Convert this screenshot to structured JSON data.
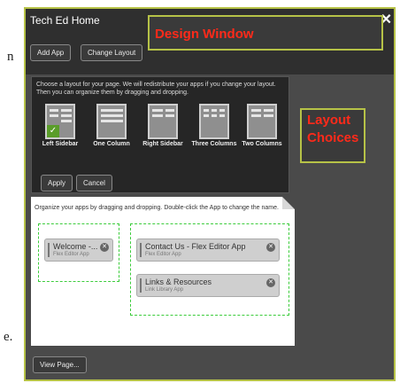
{
  "doc": {
    "left_letter": "n",
    "bottom_letter": "e."
  },
  "window": {
    "title": "Tech Ed Home",
    "close_symbol": "✕",
    "add_app_label": "Add App",
    "change_layout_label": "Change Layout",
    "view_page_label": "View Page..."
  },
  "callouts": {
    "design_window": "Design Window",
    "layout_line1": "Layout",
    "layout_line2": "Choices"
  },
  "layout_panel": {
    "instructions": "Choose a layout for your page. We will redistribute your apps if you change your layout. Then you can organize them by dragging and dropping.",
    "options": [
      "Left Sidebar",
      "One Column",
      "Right Sidebar",
      "Three Columns",
      "Two Columns"
    ],
    "selected": "Left Sidebar",
    "apply_label": "Apply",
    "cancel_label": "Cancel"
  },
  "organize": {
    "instructions": "Organize your apps by dragging and dropping. Double-click the App to change the name.",
    "apps": [
      {
        "name": "Welcome -...",
        "type": "Flex Editor App"
      },
      {
        "name": "Contact Us - Flex Editor App",
        "type": "Flex Editor App"
      },
      {
        "name": "Links & Resources",
        "type": "Link Library App"
      }
    ]
  },
  "colors": {
    "accent_border": "#b6c247",
    "callout_text": "#ff2a1a",
    "drop_zone": "#3ccc3c",
    "selected_check": "#5a9d2a"
  }
}
